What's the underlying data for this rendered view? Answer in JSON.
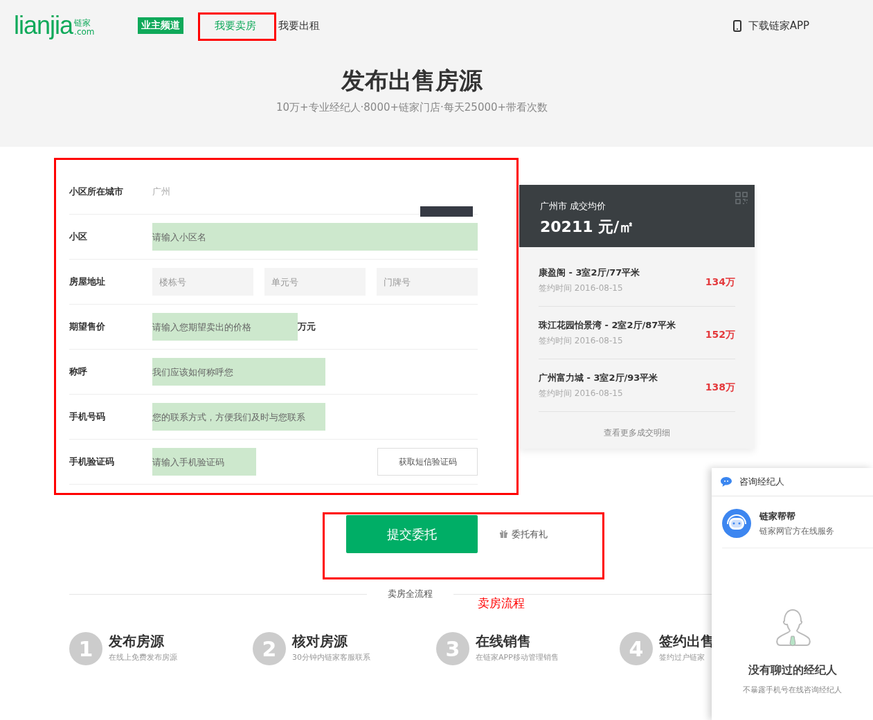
{
  "header": {
    "logo": {
      "wordmark": "lianjia",
      "cn": "链家",
      "domain": ".com"
    },
    "channel_badge": "业主频道",
    "nav": [
      {
        "label": "我要卖房",
        "selected": true
      },
      {
        "label": "我要出租",
        "selected": false
      }
    ],
    "download": "下载链家APP"
  },
  "hero": {
    "title": "发布出售房源",
    "subtitle": "10万+专业经纪人·8000+链家门店·每天25000+带看次数"
  },
  "form": {
    "rows": [
      {
        "kind": "text",
        "label": "小区所在城市",
        "value": "广州"
      },
      {
        "kind": "input",
        "label": "小区",
        "placeholder": "请输入小区名",
        "highlighted": true
      },
      {
        "kind": "address",
        "label": "房屋地址",
        "fields": [
          {
            "placeholder": "楼栋号",
            "highlighted": false
          },
          {
            "placeholder": "单元号",
            "highlighted": false
          },
          {
            "placeholder": "门牌号",
            "highlighted": false
          }
        ]
      },
      {
        "kind": "input",
        "label": "期望售价",
        "placeholder": "请输入您期望卖出的价格",
        "highlighted": true,
        "unit": "万元"
      },
      {
        "kind": "input",
        "label": "称呼",
        "placeholder": "我们应该如何称呼您",
        "highlighted": true
      },
      {
        "kind": "input",
        "label": "手机号码",
        "placeholder": "您的联系方式，方便我们及时与您联系",
        "highlighted": true
      },
      {
        "kind": "code",
        "label": "手机验证码",
        "placeholder": "请输入手机验证码",
        "highlighted": true,
        "button": "获取短信验证码"
      }
    ],
    "submit": "提交委托",
    "gift": "委托有礼"
  },
  "price_card": {
    "city": "广州市 成交均价",
    "price": "20211 元/㎡",
    "deals": [
      {
        "title": "康盈阁 - 3室2厅/77平米",
        "date": "签约时间 2016-08-15",
        "price": "134万"
      },
      {
        "title": "珠江花园怡景湾 - 2室2厅/87平米",
        "date": "签约时间 2016-08-15",
        "price": "152万"
      },
      {
        "title": "广州富力城 - 3室2厅/93平米",
        "date": "签约时间 2016-08-15",
        "price": "138万"
      }
    ],
    "more": "查看更多成交明细"
  },
  "process": {
    "title": "卖房全流程",
    "steps": [
      {
        "number": "1",
        "title": "发布房源",
        "desc": "在线上免费发布房源"
      },
      {
        "number": "2",
        "title": "核对房源",
        "desc": "30分钟内链家客服联系"
      },
      {
        "number": "3",
        "title": "在线销售",
        "desc": "在链家APP移动管理销售"
      },
      {
        "number": "4",
        "title": "签约出售",
        "desc": "签约过户链家"
      }
    ]
  },
  "chat": {
    "title": "咨询经纪人",
    "agent": {
      "name": "链家帮帮",
      "desc": "链家网官方在线服务"
    },
    "empty_title": "没有聊过的经纪人",
    "empty_desc": "不暴露手机号在线咨询经纪人"
  },
  "annotations": {
    "process_note": "卖房流程"
  }
}
